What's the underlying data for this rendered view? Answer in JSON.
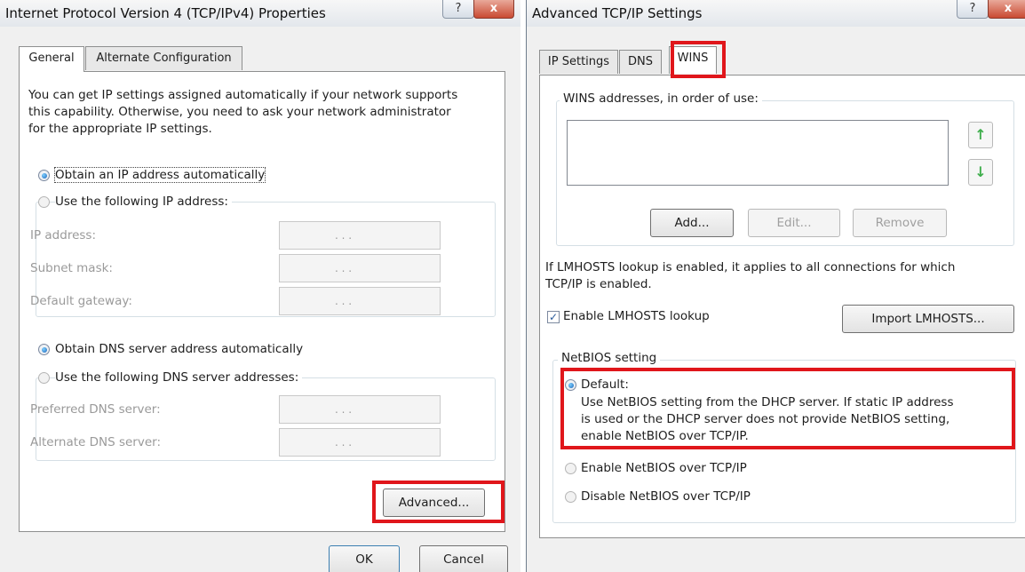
{
  "left_dialog": {
    "title": "Internet Protocol Version 4 (TCP/IPv4) Properties",
    "help_glyph": "?",
    "close_glyph": "x",
    "tabs": [
      "General",
      "Alternate Configuration"
    ],
    "description": [
      "You can get IP settings assigned automatically if your network supports",
      "this capability. Otherwise, you need to ask your network administrator",
      "for the appropriate IP settings."
    ],
    "ip_auto": "Obtain an IP address automatically",
    "ip_manual": "Use the following IP address:",
    "ip_fields": {
      "ip_label": "IP address:",
      "subnet_label": "Subnet mask:",
      "gateway_label": "Default gateway:"
    },
    "dns_auto": "Obtain DNS server address automatically",
    "dns_manual": "Use the following DNS server addresses:",
    "dns_fields": {
      "preferred_label": "Preferred DNS server:",
      "alternate_label": "Alternate DNS server:"
    },
    "ip_dots": ".     .     .",
    "advanced_label": "Advanced...",
    "ok_label": "OK",
    "cancel_label": "Cancel"
  },
  "right_dialog": {
    "title": "Advanced TCP/IP Settings",
    "help_glyph": "?",
    "close_glyph": "x",
    "tabs": [
      "IP Settings",
      "DNS",
      "WINS"
    ],
    "wins_group_label": "WINS addresses, in order of use:",
    "up_arrow": "↑",
    "down_arrow": "↓",
    "add_label": "Add...",
    "edit_label": "Edit...",
    "remove_label": "Remove",
    "lmhosts_note": [
      "If LMHOSTS lookup is enabled, it applies to all connections for which",
      "TCP/IP is enabled."
    ],
    "enable_lmhosts": "Enable LMHOSTS lookup",
    "check_glyph": "✓",
    "import_label": "Import LMHOSTS...",
    "netbios_group_label": "NetBIOS setting",
    "netbios_default": "Default:",
    "netbios_default_desc": [
      "Use NetBIOS setting from the DHCP server. If static IP address",
      "is used or the DHCP server does not provide NetBIOS setting,",
      "enable NetBIOS over TCP/IP."
    ],
    "netbios_enable": "Enable NetBIOS over TCP/IP",
    "netbios_disable": "Disable NetBIOS over TCP/IP"
  },
  "colors": {
    "highlight_red": "#e0161b",
    "dialog_bg": "#f0f0f0",
    "border": "#8e8f8f"
  }
}
